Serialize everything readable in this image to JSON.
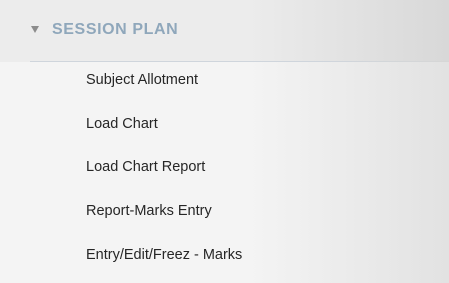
{
  "menu": {
    "header_label": "SESSION PLAN",
    "expanded_icon": "triangle-down-icon",
    "items": [
      {
        "label": "Subject Allotment"
      },
      {
        "label": "Load Chart"
      },
      {
        "label": "Load Chart Report"
      },
      {
        "label": "Report-Marks Entry"
      },
      {
        "label": "Entry/Edit/Freez - Marks"
      }
    ]
  },
  "colors": {
    "header_text": "#8fa7bb",
    "item_text": "#262626",
    "header_bg": "#ececec",
    "body_bg": "#f4f4f4"
  }
}
